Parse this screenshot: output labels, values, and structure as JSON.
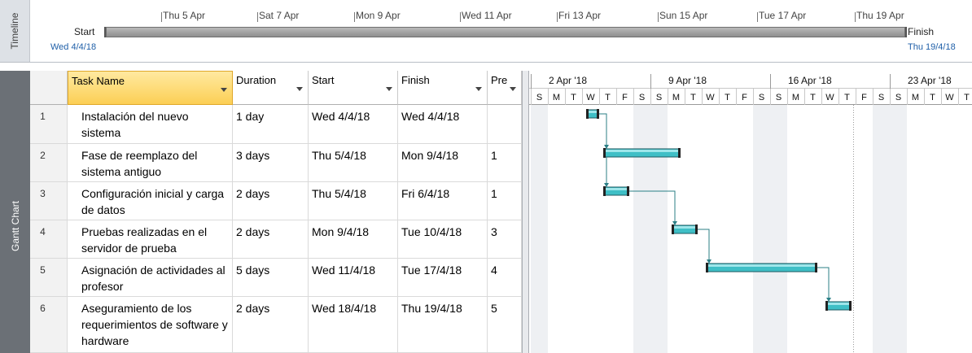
{
  "timeline": {
    "side_label": "Timeline",
    "start_label": "Start",
    "start_date": "Wed 4/4/18",
    "finish_label": "Finish",
    "finish_date": "Thu 19/4/18",
    "dates": [
      "Thu 5 Apr",
      "Sat 7 Apr",
      "Mon 9 Apr",
      "Wed 11 Apr",
      "Fri 13 Apr",
      "Sun 15 Apr",
      "Tue 17 Apr",
      "Thu 19 Apr"
    ]
  },
  "gantt": {
    "side_label": "Gantt Chart",
    "columns": {
      "name": "Task Name",
      "duration": "Duration",
      "start": "Start",
      "finish": "Finish",
      "pre": "Pre"
    },
    "tasks": [
      {
        "id": "1",
        "name": "Instalación del nuevo sistema",
        "duration": "1 day",
        "start": "Wed 4/4/18",
        "finish": "Wed 4/4/18",
        "pre": ""
      },
      {
        "id": "2",
        "name": "Fase de reemplazo del sistema antiguo",
        "duration": "3 days",
        "start": "Thu 5/4/18",
        "finish": "Mon 9/4/18",
        "pre": "1"
      },
      {
        "id": "3",
        "name": "Configuración inicial y carga de datos",
        "duration": "2 days",
        "start": "Thu 5/4/18",
        "finish": "Fri 6/4/18",
        "pre": "1"
      },
      {
        "id": "4",
        "name": "Pruebas realizadas en el servidor de prueba",
        "duration": "2 days",
        "start": "Mon 9/4/18",
        "finish": "Tue 10/4/18",
        "pre": "3"
      },
      {
        "id": "5",
        "name": "Asignación de actividades al profesor",
        "duration": "5 days",
        "start": "Wed 11/4/18",
        "finish": "Tue 17/4/18",
        "pre": "4"
      },
      {
        "id": "6",
        "name": "Aseguramiento de los requerimientos de software y hardware",
        "duration": "2 days",
        "start": "Wed 18/4/18",
        "finish": "Thu 19/4/18",
        "pre": "5"
      }
    ],
    "weeks": [
      "2 Apr '18",
      "9 Apr '18",
      "16 Apr '18",
      "23 Apr '18"
    ],
    "day_letters": [
      "S",
      "M",
      "T",
      "W",
      "T",
      "F",
      "S"
    ],
    "bar_color": "#3fbfc6",
    "link_color": "#2b7f86"
  }
}
